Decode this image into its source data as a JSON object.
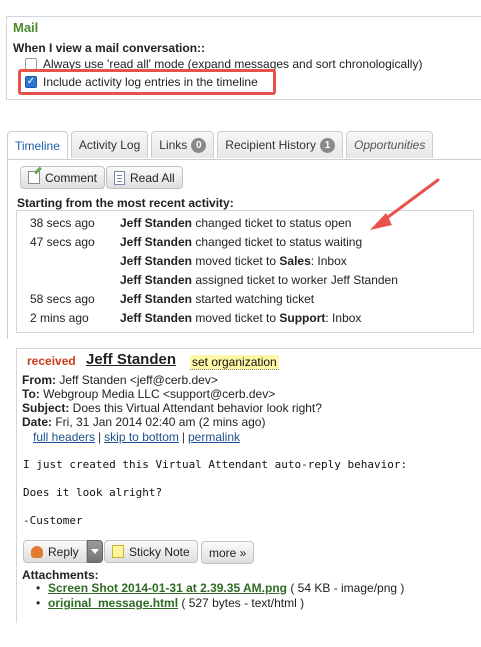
{
  "mail": {
    "title": "Mail",
    "question": "When I view a mail conversation::",
    "options": [
      {
        "label": "Always use 'read all' mode (expand messages and sort chronologically)",
        "checked": false
      },
      {
        "label": "Include activity log entries in the timeline",
        "checked": true
      }
    ],
    "highlight_color": "#e8524a"
  },
  "tabs": [
    {
      "label": "Timeline",
      "active": true
    },
    {
      "label": "Activity Log"
    },
    {
      "label": "Links",
      "badge": "0"
    },
    {
      "label": "Recipient History",
      "badge": "1"
    },
    {
      "label": "Opportunities",
      "italic": true
    }
  ],
  "timeline": {
    "comment_button": "Comment",
    "read_all_button": "Read All",
    "activity_label": "Starting from the most recent activity:",
    "entries": [
      {
        "time": "38 secs ago",
        "actor": "Jeff Standen",
        "text": " changed ticket to status open"
      },
      {
        "time": "47 secs ago",
        "actor": "Jeff Standen",
        "text": " changed ticket to status waiting"
      },
      {
        "time": "",
        "actor": "Jeff Standen",
        "text": " moved ticket to ",
        "bold": "Sales",
        "suffix": ": Inbox"
      },
      {
        "time": "",
        "actor": "Jeff Standen",
        "text": " assigned ticket to worker Jeff Standen"
      },
      {
        "time": "58 secs ago",
        "actor": "Jeff Standen",
        "text": " started watching ticket"
      },
      {
        "time": "2 mins ago",
        "actor": "Jeff Standen",
        "text": " moved ticket to ",
        "bold": "Support",
        "suffix": ": Inbox"
      }
    ]
  },
  "message": {
    "status": "received",
    "sender": "Jeff Standen",
    "set_org": "set organization",
    "from_label": "From:",
    "from": " Jeff Standen <jeff@cerb.dev>",
    "to_label": "To:",
    "to": " Webgroup Media LLC <support@cerb.dev>",
    "subject_label": "Subject:",
    "subject": " Does this Virtual Attendant behavior look right?",
    "date_label": "Date:",
    "date": " Fri, 31 Jan 2014 02:40 am (2 mins ago)",
    "links": [
      "full headers",
      "skip to bottom",
      "permalink"
    ],
    "body": [
      "I just created this Virtual Attendant auto-reply behavior:",
      "Does it look alright?",
      "-Customer"
    ],
    "reply_button": "Reply",
    "sticky_button": "Sticky Note",
    "more_button": "more »",
    "attachments_label": "Attachments:",
    "attachments": [
      {
        "name": "Screen Shot 2014-01-31 at 2.39.35 AM.png",
        "meta": " ( 54 KB - image/png )"
      },
      {
        "name": "original_message.html",
        "meta": " ( 527 bytes - text/html )"
      }
    ]
  }
}
